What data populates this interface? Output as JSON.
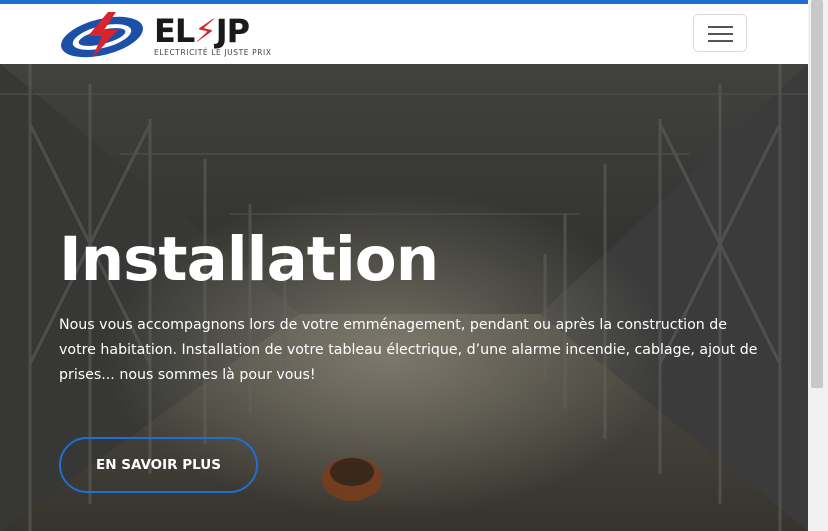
{
  "colors": {
    "accent": "#1f6fd1",
    "header_bg": "#ffffff",
    "hero_text": "#ffffff"
  },
  "header": {
    "logo": {
      "name": "EL JP",
      "tagline": "ELECTRICITÉ LE JUSTE PRIX"
    },
    "menu_icon": "hamburger-icon"
  },
  "hero": {
    "title": "Installation",
    "description": "Nous vous accompagnons lors de votre emménagement, pendant ou après la construction de votre habitation. Installation de votre tableau électrique, d’une alarme incendie, cablage, ajout de prises... nous sommes là pour vous!",
    "cta_label": "EN SAVOIR PLUS"
  }
}
